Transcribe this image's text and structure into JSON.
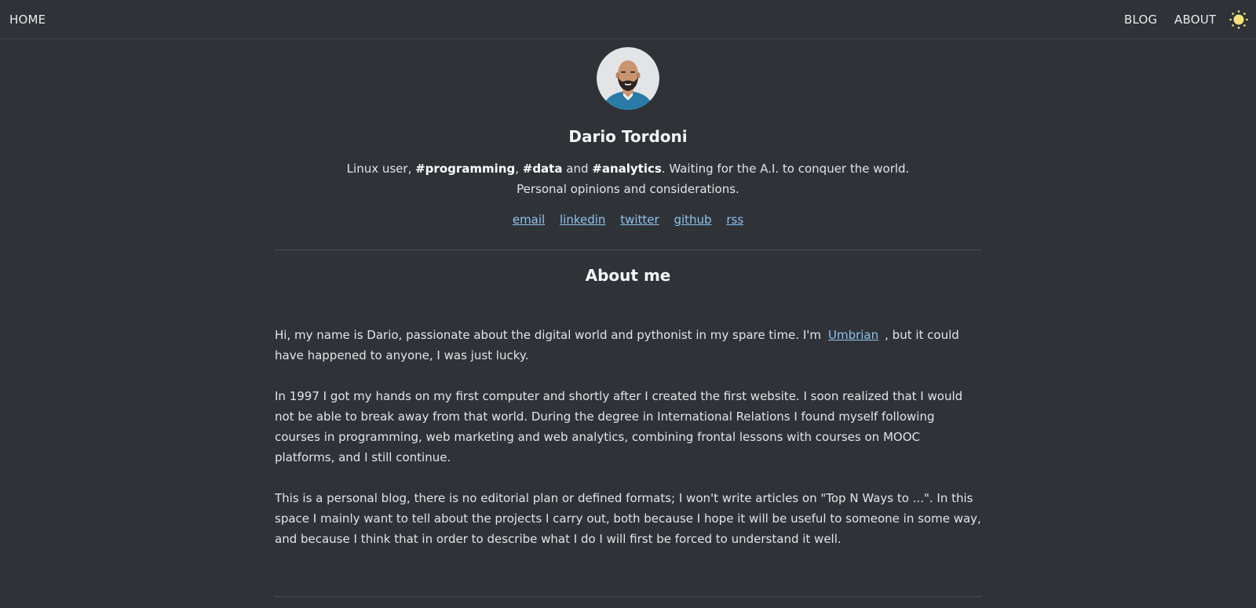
{
  "nav": {
    "home": "HOME",
    "blog": "BLOG",
    "about": "ABOUT"
  },
  "icons": {
    "theme_toggle": "sun-icon",
    "avatar": "avatar-illustration"
  },
  "colors": {
    "background": "#2f3338",
    "link": "#8fc3ec",
    "sun": "#f7e27c"
  },
  "profile": {
    "name": "Dario Tordoni",
    "bio_line1_part1": "Linux user, ",
    "tag_programming": "#programming",
    "bio_comma": ", ",
    "tag_data": "#data",
    "bio_and": " and ",
    "tag_analytics": "#analytics",
    "bio_line1_part2": ". Waiting for the A.I. to conquer the world.",
    "bio_line2": "Personal opinions and considerations.",
    "links": {
      "email": "email",
      "linkedin": "linkedin",
      "twitter": "twitter",
      "github": "github",
      "rss": "rss"
    }
  },
  "about": {
    "title": "About me",
    "p1_before": "Hi, my name is Dario, passionate about the digital world and pythonist in my spare time. I'm",
    "p1_link": "Umbrian",
    "p1_after": ", but it could have happened to anyone, I was just lucky.",
    "p2": "In 1997 I got my hands on my first computer and shortly after I created the first website. I soon realized that I would not be able to break away from that world. During the degree in International Relations I found myself following courses in programming, web marketing and web analytics, combining frontal lessons with courses on MOOC platforms, and I still continue.",
    "p3": "This is a personal blog, there is no editorial plan or defined formats; I won't write articles on \"Top N Ways to ...\". In this space I mainly want to tell about the projects I carry out, both because I hope it will be useful to someone in some way, and because I think that in order to describe what I do I will first be forced to understand it well."
  }
}
